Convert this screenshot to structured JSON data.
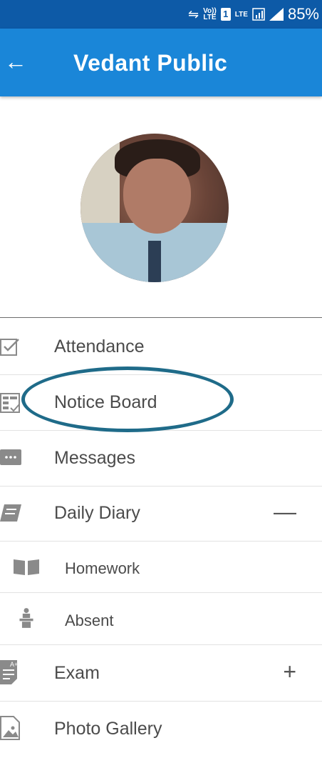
{
  "status_bar": {
    "volte_top": "Vo))",
    "volte_bottom": "LTE",
    "sim": "1",
    "lte": "LTE",
    "battery": "85%"
  },
  "appbar": {
    "back_icon": "arrow-left-icon",
    "title": "Vedant Public"
  },
  "menu": {
    "items": [
      {
        "label": "Attendance",
        "icon": "checkbox-icon"
      },
      {
        "label": "Notice Board",
        "icon": "checklist-icon"
      },
      {
        "label": "Messages",
        "icon": "chat-bubble-icon"
      },
      {
        "label": "Daily Diary",
        "icon": "notebook-icon",
        "toggle": "—"
      },
      {
        "label": "Homework",
        "icon": "open-book-icon"
      },
      {
        "label": "Absent",
        "icon": "person-at-desk-icon"
      },
      {
        "label": "Exam",
        "icon": "graded-sheet-icon",
        "toggle": "+"
      },
      {
        "label": "Photo Gallery",
        "icon": "image-file-icon"
      }
    ]
  },
  "colors": {
    "status_bar": "#0d5aa7",
    "app_bar": "#1a86d8",
    "highlight_ring": "#1f6b89"
  }
}
